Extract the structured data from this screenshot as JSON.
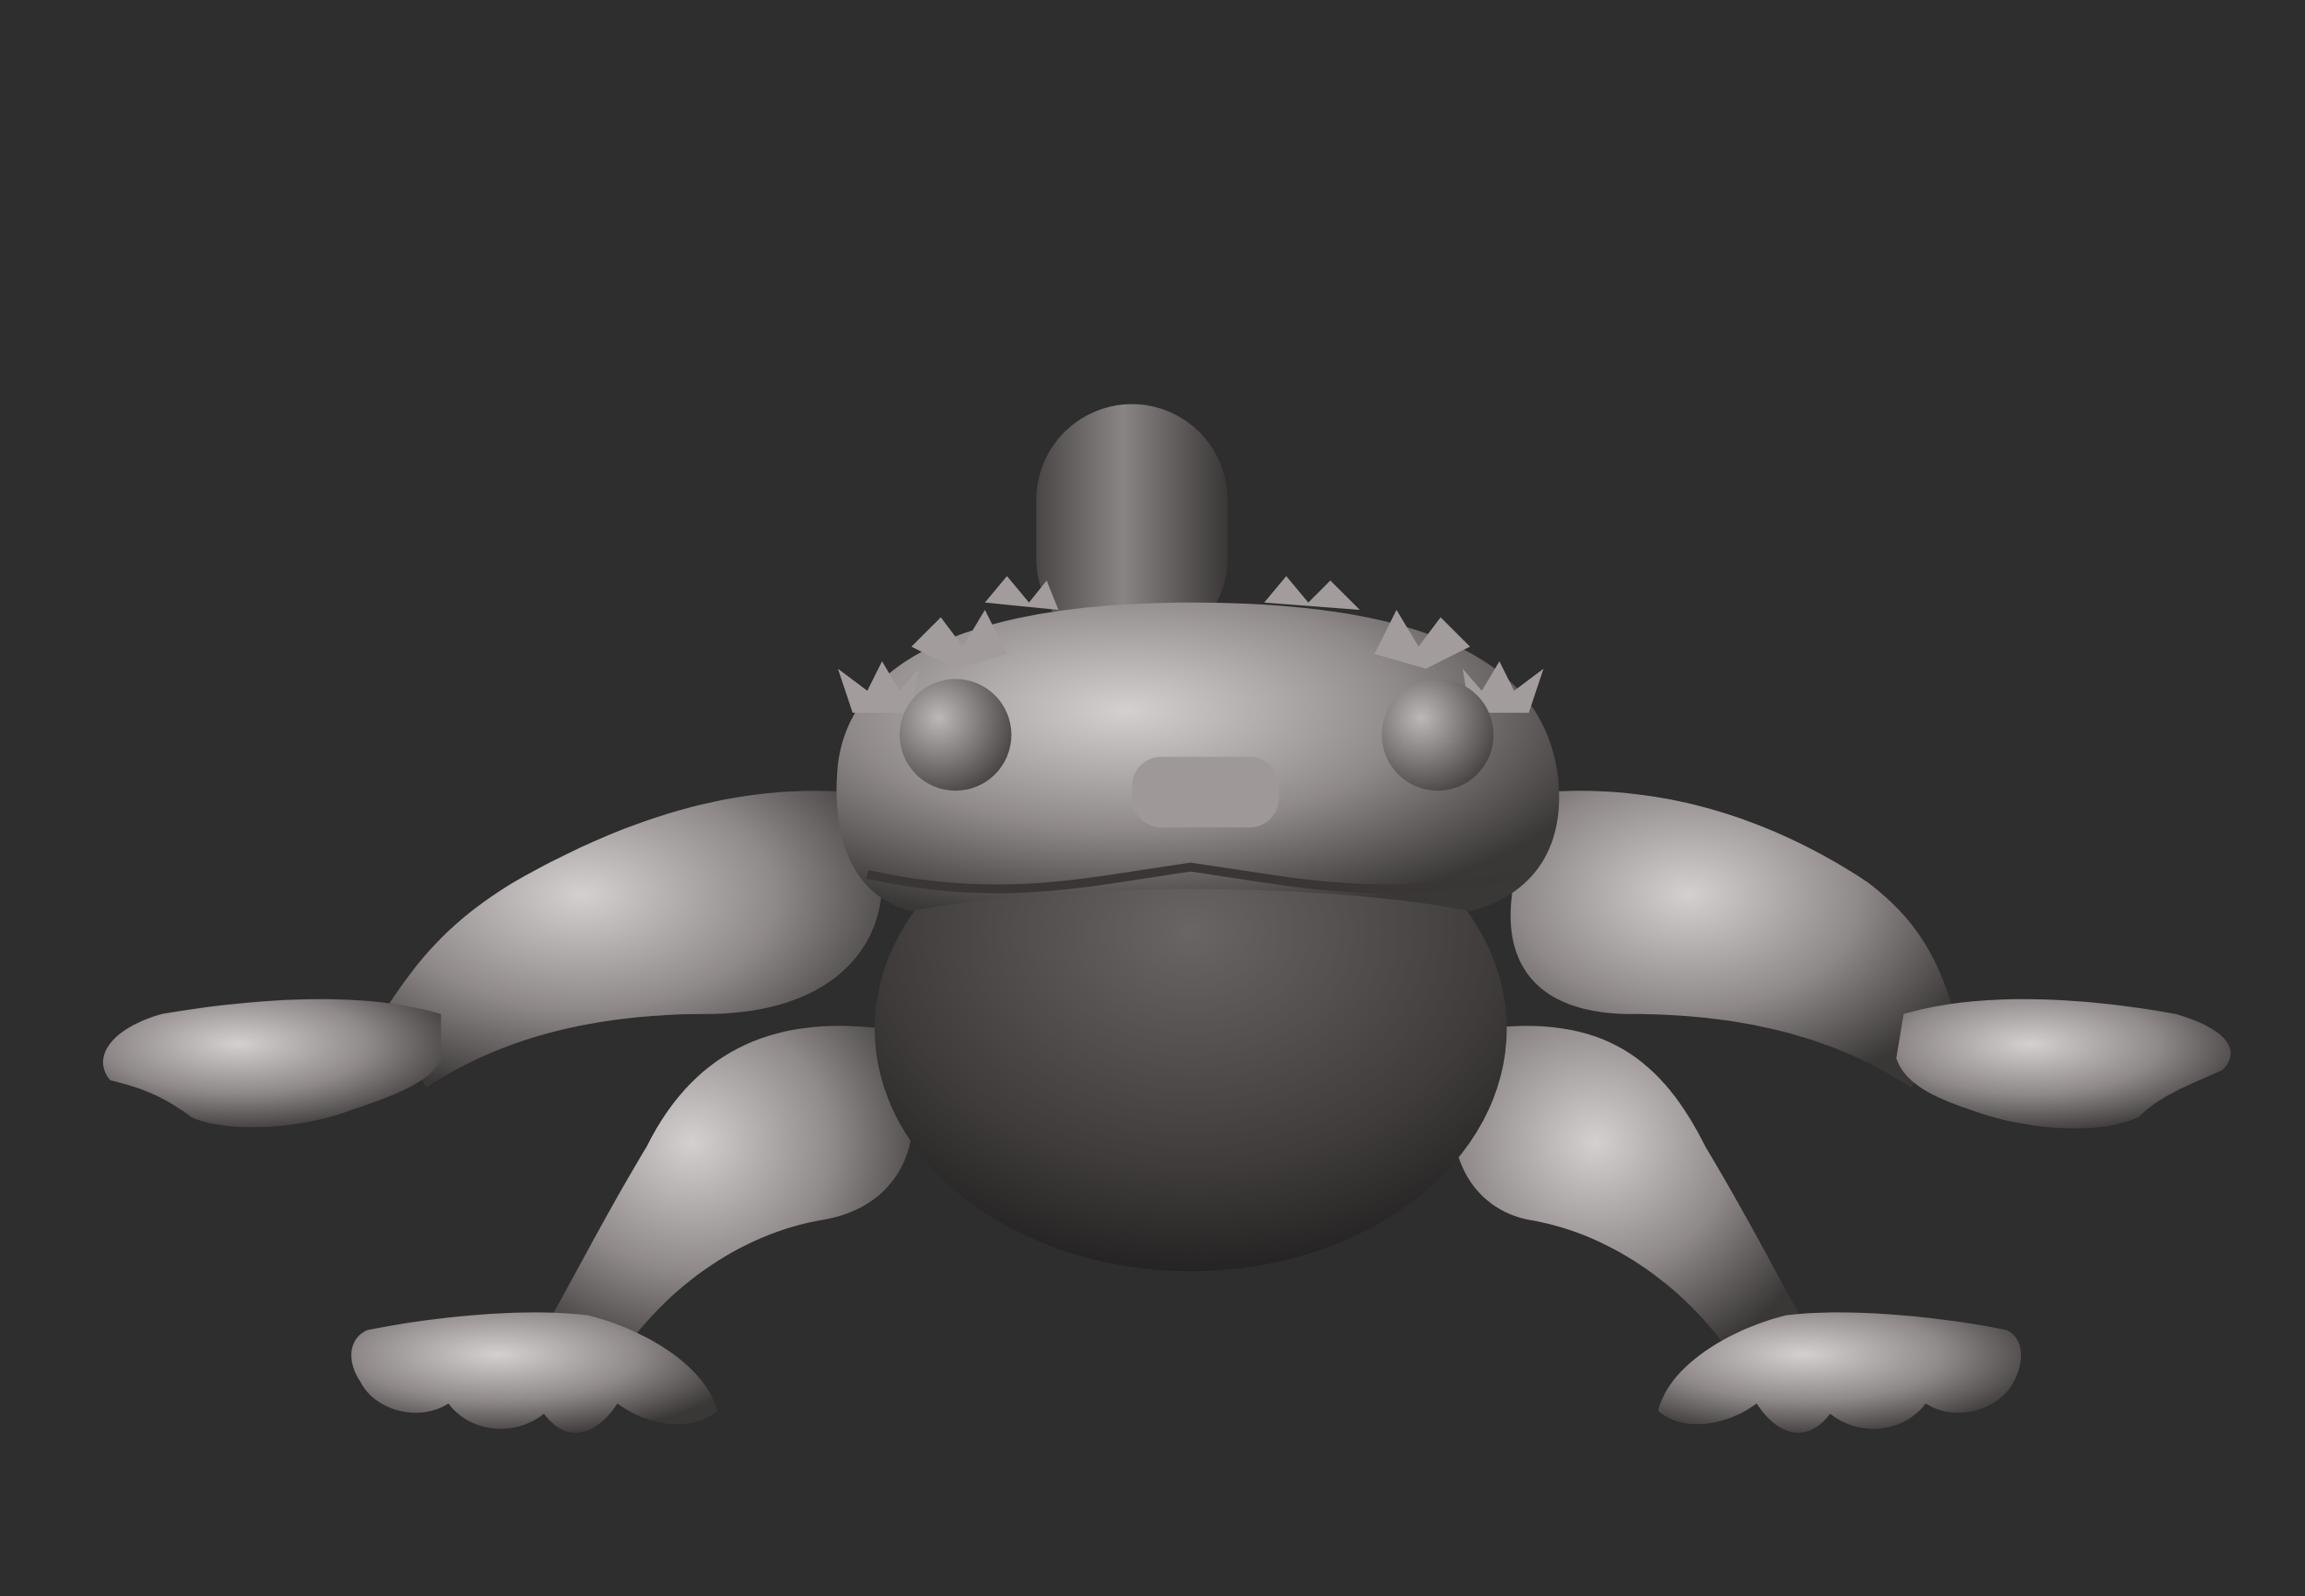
{
  "scene": {
    "subject": "gecko-sculpt",
    "colors": {
      "background": "#2e2e2e",
      "clay_light": "#d4d0cf",
      "clay_mid": "#8f8a89",
      "clay_dark": "#3a3737"
    }
  }
}
